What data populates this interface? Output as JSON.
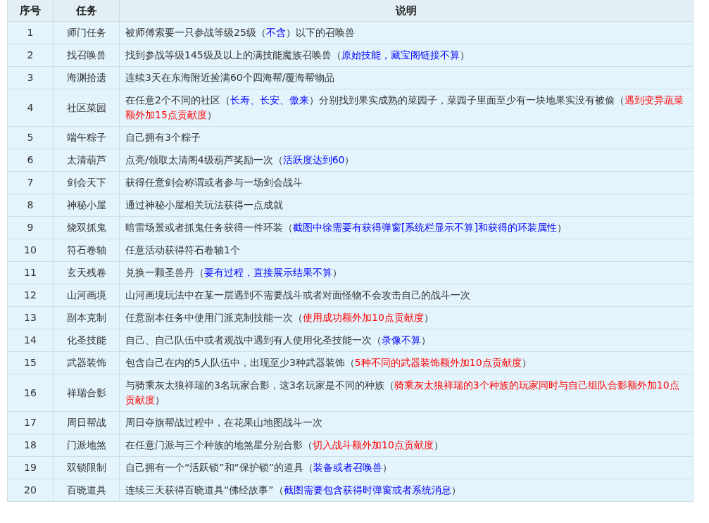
{
  "table": {
    "columns": [
      "序号",
      "任务",
      "说明"
    ],
    "rows": [
      {
        "no": "1",
        "task": "师门任务",
        "description": [
          {
            "kind": "text",
            "text": "被师傅索要一只参战等级25级（"
          },
          {
            "kind": "note",
            "text": "不含"
          },
          {
            "kind": "text",
            "text": "）以下的召唤兽"
          }
        ]
      },
      {
        "no": "2",
        "task": "找召唤兽",
        "description": [
          {
            "kind": "text",
            "text": "找到参战等级145级及以上的满技能魔族召唤兽（"
          },
          {
            "kind": "note",
            "text": "原始技能，藏宝阁链接不算"
          },
          {
            "kind": "text",
            "text": "）"
          }
        ]
      },
      {
        "no": "3",
        "task": "海渊拾遗",
        "description": [
          {
            "kind": "text",
            "text": "连续3天在东海附近捡满60个四海帮/覆海帮物品"
          }
        ]
      },
      {
        "no": "4",
        "task": "社区菜园",
        "description": [
          {
            "kind": "text",
            "text": "在任意2个不同的社区（"
          },
          {
            "kind": "note",
            "text": "长寿、长安、傲来"
          },
          {
            "kind": "text",
            "text": "）分别找到果实成熟的菜园子，菜园子里面至少有一块地果实没有被偷（"
          },
          {
            "kind": "bonus",
            "text": "遇到变异蔬菜额外加15点贡献度"
          },
          {
            "kind": "text",
            "text": "）"
          }
        ]
      },
      {
        "no": "5",
        "task": "端午粽子",
        "description": [
          {
            "kind": "text",
            "text": "自己拥有3个粽子"
          }
        ]
      },
      {
        "no": "6",
        "task": "太清葫芦",
        "description": [
          {
            "kind": "text",
            "text": "点亮/领取太清阁4级葫芦奖励一次（"
          },
          {
            "kind": "note",
            "text": "活跃度达到60"
          },
          {
            "kind": "text",
            "text": "）"
          }
        ]
      },
      {
        "no": "7",
        "task": "剑会天下",
        "description": [
          {
            "kind": "text",
            "text": "获得任意剑会称谓或者参与一场剑会战斗"
          }
        ]
      },
      {
        "no": "8",
        "task": "神秘小屋",
        "description": [
          {
            "kind": "text",
            "text": "通过神秘小屋相关玩法获得一点成就"
          }
        ]
      },
      {
        "no": "9",
        "task": "烧双抓鬼",
        "description": [
          {
            "kind": "text",
            "text": "暗雷场景或者抓鬼任务获得一件环装（"
          },
          {
            "kind": "note",
            "text": "截图中徐需要有获得弹窗[系统栏显示不算]和获得的环装属性"
          },
          {
            "kind": "text",
            "text": "）"
          }
        ]
      },
      {
        "no": "10",
        "task": "符石卷轴",
        "description": [
          {
            "kind": "text",
            "text": "任意活动获得符石卷轴1个"
          }
        ]
      },
      {
        "no": "11",
        "task": "玄天残卷",
        "description": [
          {
            "kind": "text",
            "text": "兑换一颗圣兽丹（"
          },
          {
            "kind": "note",
            "text": "要有过程，直接展示结果不算"
          },
          {
            "kind": "text",
            "text": "）"
          }
        ]
      },
      {
        "no": "12",
        "task": "山河画境",
        "description": [
          {
            "kind": "text",
            "text": "山河画境玩法中在某一层遇到不需要战斗或者对面怪物不会攻击自己的战斗一次"
          }
        ]
      },
      {
        "no": "13",
        "task": "副本克制",
        "description": [
          {
            "kind": "text",
            "text": "任意副本任务中使用门派克制技能一次（"
          },
          {
            "kind": "bonus",
            "text": "使用成功额外加10点贡献度"
          },
          {
            "kind": "text",
            "text": "）"
          }
        ]
      },
      {
        "no": "14",
        "task": "化圣技能",
        "description": [
          {
            "kind": "text",
            "text": "自己、自己队伍中或者观战中遇到有人使用化圣技能一次（"
          },
          {
            "kind": "note",
            "text": "录像不算"
          },
          {
            "kind": "text",
            "text": "）"
          }
        ]
      },
      {
        "no": "15",
        "task": "武器装饰",
        "description": [
          {
            "kind": "text",
            "text": "包含自己在内的5人队伍中，出现至少3种武器装饰（"
          },
          {
            "kind": "bonus",
            "text": "5种不同的武器装饰额外加10点贡献度"
          },
          {
            "kind": "text",
            "text": "）"
          }
        ]
      },
      {
        "no": "16",
        "task": "祥瑞合影",
        "description": [
          {
            "kind": "text",
            "text": "与骑乘灰太狼祥瑞的3名玩家合影，这3名玩家是不同的种族（"
          },
          {
            "kind": "bonus",
            "text": "骑乘灰太狼祥瑞的3个种族的玩家同时与自己组队合影额外加10点贡献度"
          },
          {
            "kind": "text",
            "text": "）"
          }
        ]
      },
      {
        "no": "17",
        "task": "周日帮战",
        "description": [
          {
            "kind": "text",
            "text": "周日夺旗帮战过程中，在花果山地图战斗一次"
          }
        ]
      },
      {
        "no": "18",
        "task": "门派地煞",
        "description": [
          {
            "kind": "text",
            "text": "在任意门派与三个种族的地煞星分别合影（"
          },
          {
            "kind": "bonus",
            "text": "切入战斗额外加10点贡献度"
          },
          {
            "kind": "text",
            "text": "）"
          }
        ]
      },
      {
        "no": "19",
        "task": "双锁限制",
        "description": [
          {
            "kind": "text",
            "text": "自己拥有一个“活跃锁”和“保护锁”的道具（"
          },
          {
            "kind": "note",
            "text": "装备或者召唤兽"
          },
          {
            "kind": "text",
            "text": "）"
          }
        ]
      },
      {
        "no": "20",
        "task": "百晓道具",
        "description": [
          {
            "kind": "text",
            "text": "连续三天获得百晓道具“佛经故事”（"
          },
          {
            "kind": "note",
            "text": "截图需要包含获得时弹窗或者系统消息"
          },
          {
            "kind": "text",
            "text": "）"
          }
        ]
      }
    ]
  }
}
